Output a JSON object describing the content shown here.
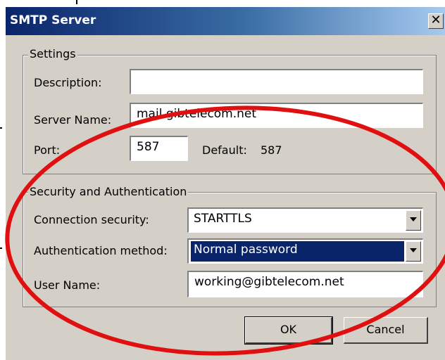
{
  "dialog": {
    "title": "SMTP Server",
    "close_symbol": "✕"
  },
  "settings": {
    "legend": "Settings",
    "description_label": "Description:",
    "description_value": "",
    "server_name_label": "Server Name:",
    "server_name_value": "mail.gibtelecom.net",
    "port_label": "Port:",
    "port_value": "587",
    "default_label": "Default:",
    "default_value": "587"
  },
  "security": {
    "legend": "Security and Authentication",
    "connection_label": "Connection security:",
    "connection_value": "STARTTLS",
    "auth_label": "Authentication method:",
    "auth_value": "Normal password",
    "username_label": "User Name:",
    "username_value": "working@gibtelecom.net"
  },
  "buttons": {
    "ok": "OK",
    "cancel": "Cancel"
  },
  "colors": {
    "titlebar_start": "#0a246a",
    "dialog_bg": "#d4d0c8",
    "selection": "#0a246a",
    "annotation": "#e01010"
  }
}
